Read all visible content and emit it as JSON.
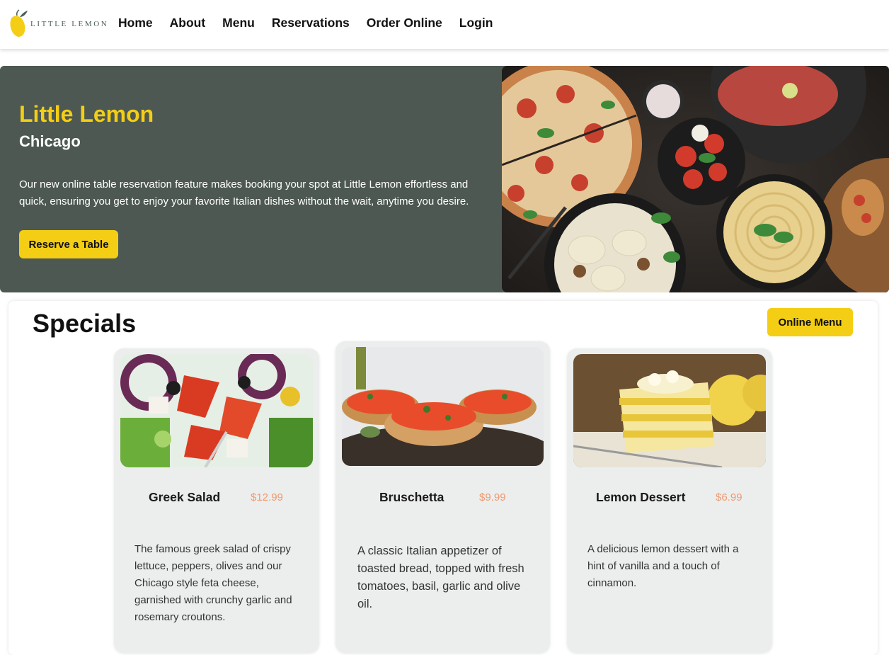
{
  "brand": {
    "logo_text": "LITTLE LEMON",
    "primary_color": "#495e57",
    "accent_color": "#f4ce14",
    "price_color": "#ee9972"
  },
  "nav": {
    "items": [
      {
        "label": "Home"
      },
      {
        "label": "About"
      },
      {
        "label": "Menu"
      },
      {
        "label": "Reservations"
      },
      {
        "label": "Order Online"
      },
      {
        "label": "Login"
      }
    ]
  },
  "hero": {
    "title": "Little Lemon",
    "subtitle": "Chicago",
    "description": "Our new online table reservation feature makes booking your spot at Little Lemon effortless and quick, ensuring you get to enjoy your favorite Italian dishes without the wait, anytime you desire.",
    "button_label": "Reserve a Table",
    "image": "italian-food-spread-photo"
  },
  "specials": {
    "title": "Specials",
    "menu_button_label": "Online Menu",
    "cards": [
      {
        "name": "Greek Salad",
        "price": "$12.99",
        "description": "The famous greek salad of crispy lettuce, peppers, olives and our Chicago style feta cheese, garnished with crunchy garlic and rosemary croutons.",
        "image": "greek-salad-photo"
      },
      {
        "name": "Bruschetta",
        "price": "$9.99",
        "description": "A classic Italian appetizer of toasted bread, topped with fresh tomatoes, basil, garlic and olive oil.",
        "image": "bruschetta-photo"
      },
      {
        "name": "Lemon Dessert",
        "price": "$6.99",
        "description": "A delicious lemon dessert with a hint of vanilla and a touch of cinnamon.",
        "image": "lemon-dessert-photo"
      }
    ]
  }
}
